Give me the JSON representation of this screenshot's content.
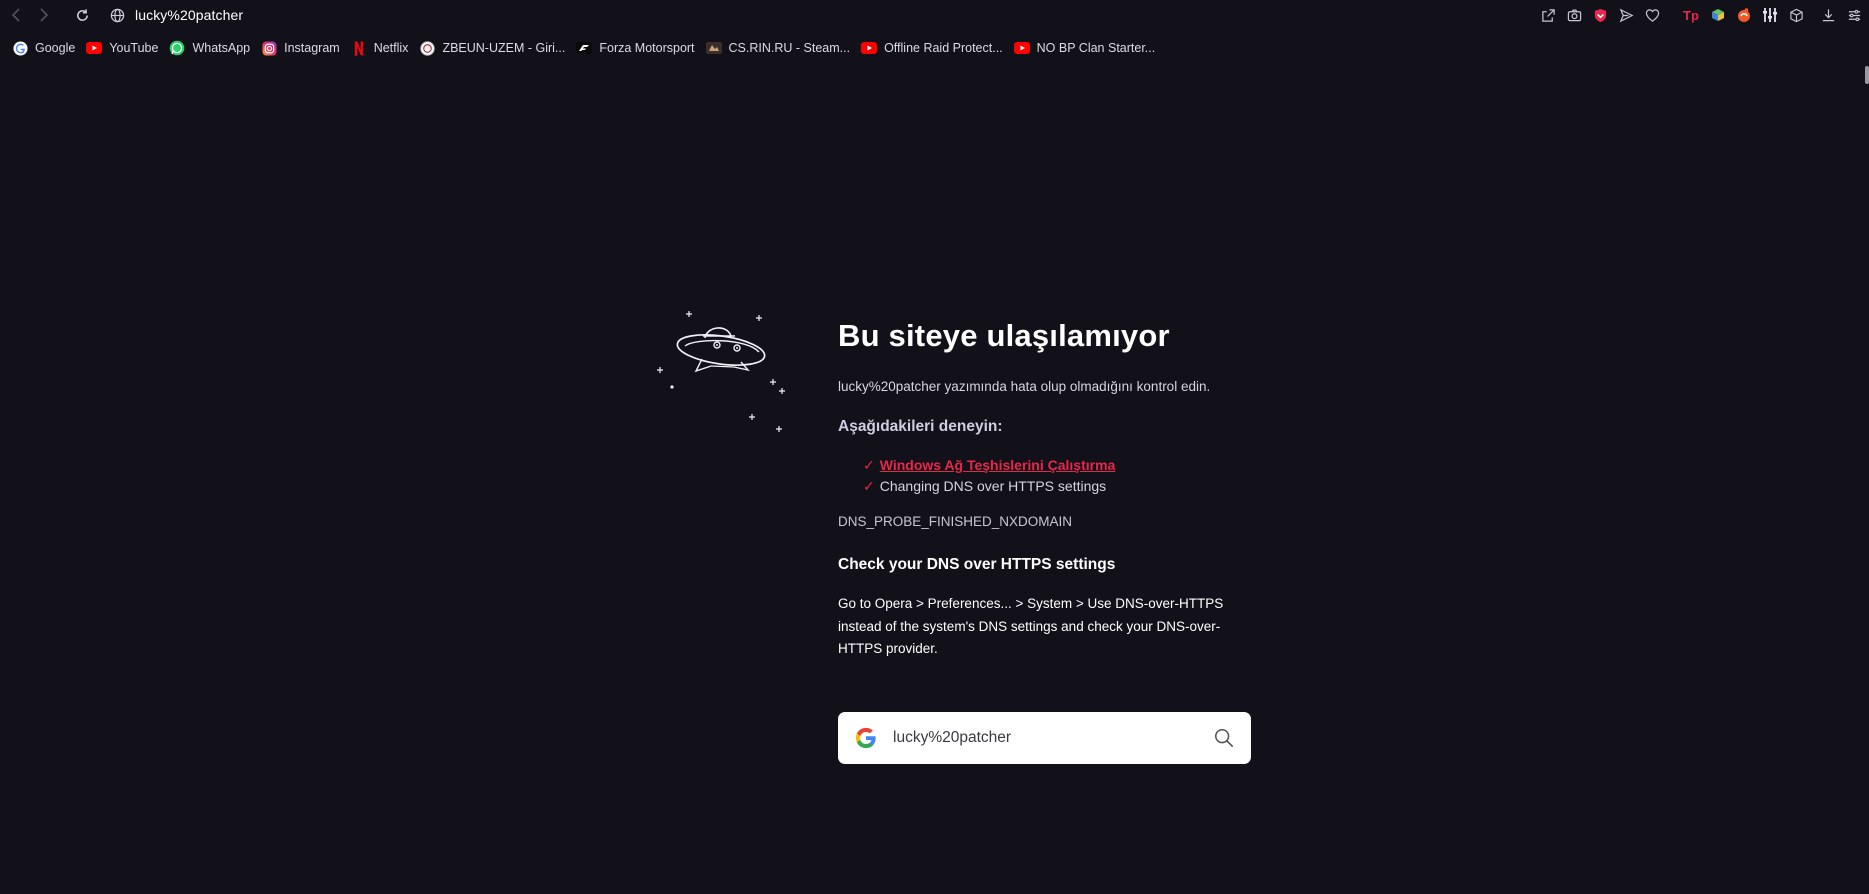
{
  "addressbar": {
    "url": "lucky%20patcher"
  },
  "bookmarks": [
    {
      "label": "Google",
      "icon": "google-icon"
    },
    {
      "label": "YouTube",
      "icon": "youtube-icon"
    },
    {
      "label": "WhatsApp",
      "icon": "whatsapp-icon"
    },
    {
      "label": "Instagram",
      "icon": "instagram-icon"
    },
    {
      "label": "Netflix",
      "icon": "netflix-icon"
    },
    {
      "label": "ZBEUN-UZEM - Giri...",
      "icon": "zbeun-icon"
    },
    {
      "label": "Forza Motorsport",
      "icon": "forza-icon"
    },
    {
      "label": "CS.RIN.RU - Steam...",
      "icon": "csrin-icon"
    },
    {
      "label": "Offline Raid Protect...",
      "icon": "youtube-icon"
    },
    {
      "label": "NO BP Clan Starter...",
      "icon": "youtube-icon"
    }
  ],
  "error": {
    "title": "Bu siteye ulaşılamıyor",
    "subtitle": "lucky%20patcher yazımında hata olup olmadığını kontrol edin.",
    "try_heading": "Aşağıdakileri deneyin:",
    "check_mark": "✓",
    "suggestions": [
      {
        "label": "Windows Ağ Teşhislerini Çalıştırma",
        "is_link": true
      },
      {
        "label": "Changing DNS over HTTPS settings",
        "is_link": false
      }
    ],
    "code": "DNS_PROBE_FINISHED_NXDOMAIN",
    "dns_heading": "Check your DNS over HTTPS settings",
    "dns_body": "Go to Opera > Preferences... > System > Use DNS-over-HTTPS instead of the system's DNS settings and check your DNS-over-HTTPS provider."
  },
  "search": {
    "query": "lucky%20patcher"
  },
  "colors": {
    "background": "#12111a",
    "accent": "#e8274b"
  }
}
